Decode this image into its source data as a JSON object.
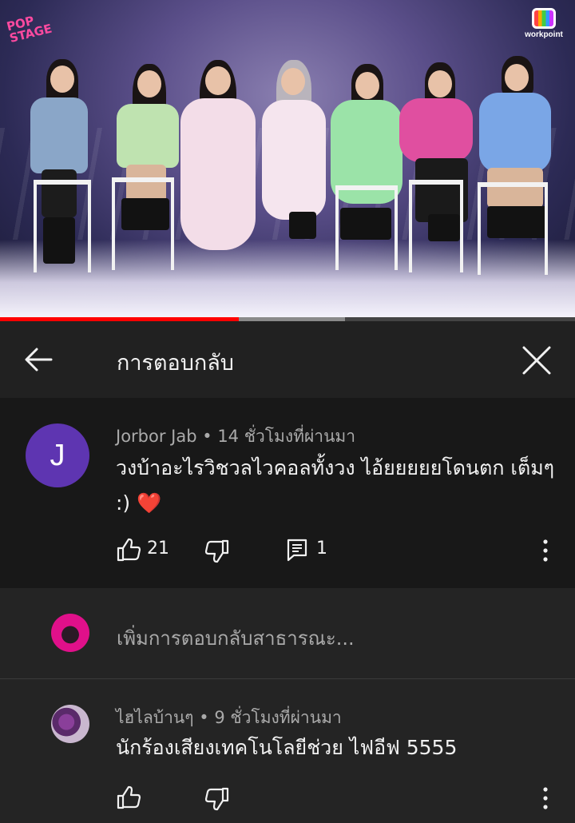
{
  "video": {
    "logo_left": "POP STAGE",
    "logo_right": "workpoint",
    "progress_fraction": 0.415,
    "buffered_fraction": 0.6,
    "colors": {
      "played": "#ff0000",
      "buffered": "#8a8a8a"
    }
  },
  "header": {
    "title": "การตอบกลับ",
    "back_icon": "arrow-left-icon",
    "close_icon": "close-icon"
  },
  "comment": {
    "avatar_letter": "J",
    "avatar_color": "#5e35b1",
    "author": "Jorbor Jab",
    "separator": " • ",
    "time": "14 ชั่วโมงที่ผ่านมา",
    "text": "วงบ้าอะไรวิชวลไวคอลทั้งวง ไอ้ยยยยยโดนตก เต็มๆ :)",
    "emoji": "❤️",
    "likes": "21",
    "replies": "1"
  },
  "add_reply": {
    "placeholder": "เพิ่มการตอบกลับสาธารณะ..."
  },
  "reply": {
    "author": "ไฮไลบ้านๆ",
    "separator": " • ",
    "time": "9 ชั่วโมงที่ผ่านมา",
    "text": "นักร้องเสียงเทคโนโลยีช่วย ไฟอีฟ 5555"
  }
}
